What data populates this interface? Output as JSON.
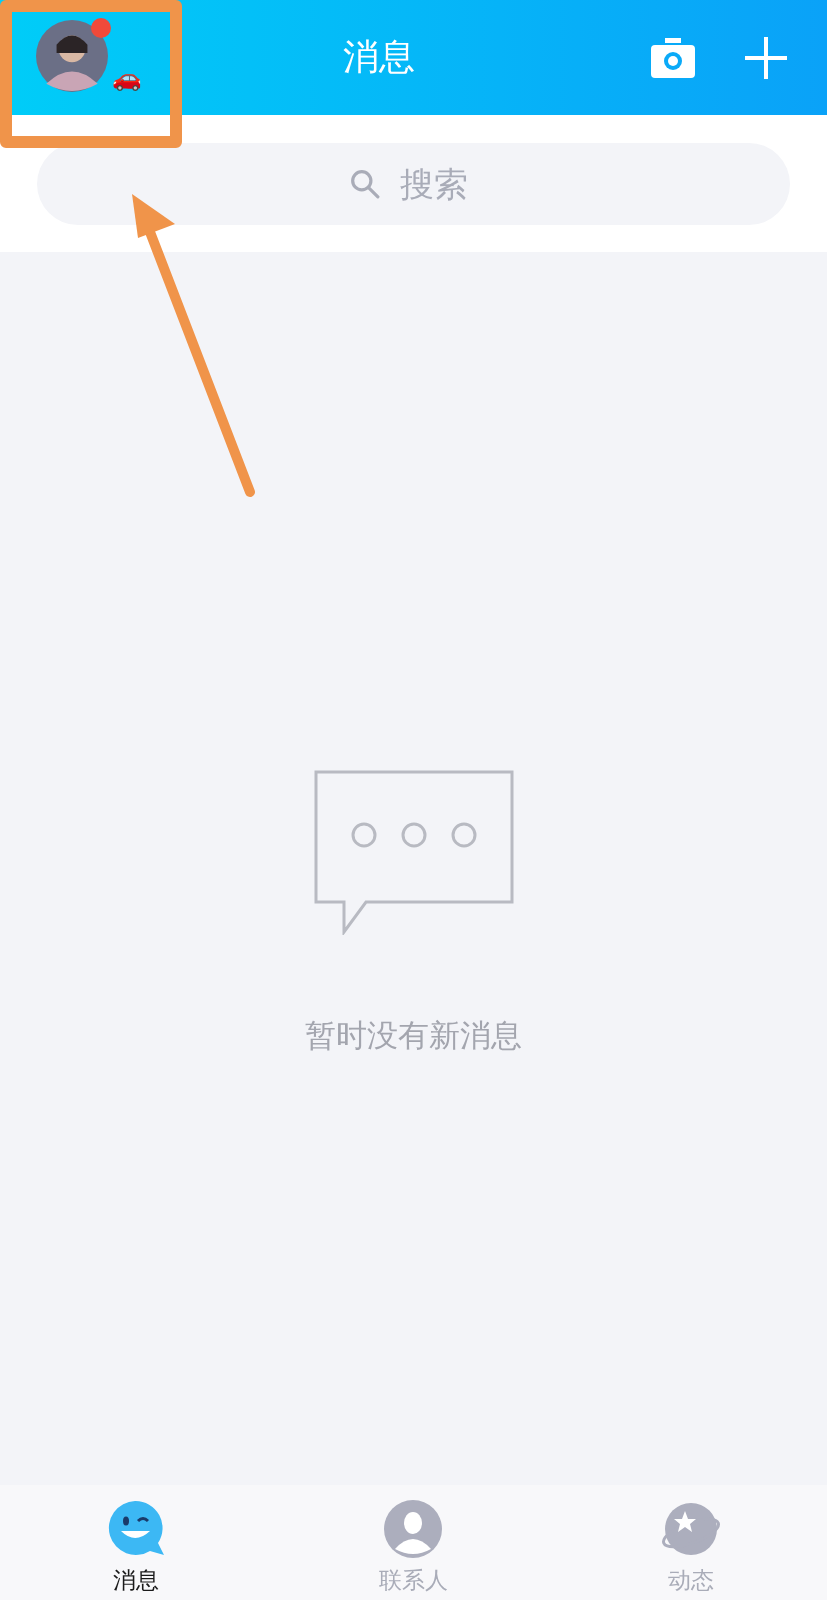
{
  "header": {
    "title": "消息",
    "has_unread_dot": true,
    "status_emoji": "🚗"
  },
  "search": {
    "placeholder": "搜索"
  },
  "empty_state": {
    "text": "暂时没有新消息"
  },
  "tabs": [
    {
      "label": "消息",
      "kind": "chat",
      "selected": true
    },
    {
      "label": "联系人",
      "kind": "contacts",
      "selected": false
    },
    {
      "label": "动态",
      "kind": "feed",
      "selected": false
    }
  ],
  "annotations": {
    "highlight_box": true,
    "arrow": true
  }
}
